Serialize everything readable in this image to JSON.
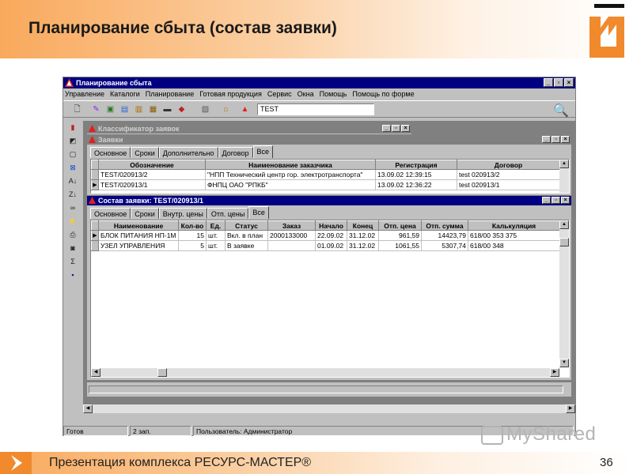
{
  "slide": {
    "title": "Планирование сбыта (состав заявки)",
    "footer_text": "Презентация комплекса РЕСУРС-МАСТЕР®",
    "page_number": "36",
    "watermark": "MyShared"
  },
  "app": {
    "title": "Планирование сбыта",
    "menu": [
      "Управление",
      "Каталоги",
      "Планирование",
      "Готовая продукция",
      "Сервис",
      "Окна",
      "Помощь",
      "Помощь по форме"
    ],
    "search_value": "TEST"
  },
  "classifier_window": {
    "title": "Классификатор заявок"
  },
  "orders_window": {
    "title": "Заявки",
    "tabs": [
      "Основное",
      "Сроки",
      "Дополнительно",
      "Договор",
      "Все"
    ],
    "columns": [
      "Обозначение",
      "Наименование заказчика",
      "Регистрация",
      "Договор"
    ],
    "rows": [
      [
        "TEST/020913/2",
        "\"НПП Технический центр гор. электротранспорта\"",
        "13.09.02 12:39:15",
        "test 020913/2"
      ],
      [
        "TEST/020913/1",
        "ФНПЦ ОАО \"РПКБ\"",
        "13.09.02 12:36:22",
        "test 020913/1"
      ]
    ]
  },
  "composition_window": {
    "title": "Состав заявки: TEST/020913/1",
    "tabs": [
      "Основное",
      "Сроки",
      "Внутр. цены",
      "Отп. цены",
      "Все"
    ],
    "columns": [
      "Наименование",
      "Кол-во",
      "Ед.",
      "Статус",
      "Заказ",
      "Начало",
      "Конец",
      "Отп. цена",
      "Отп. сумма",
      "Калькуляция"
    ],
    "rows": [
      [
        "БЛОК ПИТАНИЯ НП-1М",
        "15",
        "шт.",
        "Вкл. в план",
        "2000133000",
        "22.09.02",
        "31.12.02",
        "961,59",
        "14423,79",
        "618/00 353 375"
      ],
      [
        "УЗЕЛ УПРАВЛЕНИЯ",
        "5",
        "шт.",
        "В заявке",
        "",
        "01.09.02",
        "31.12.02",
        "1061,55",
        "5307,74",
        "618/00 348"
      ]
    ]
  },
  "statusbar": {
    "ready": "Готов",
    "records": "2 зап.",
    "user": "Пользователь: Администратор"
  },
  "colors": {
    "accent": "#f08a2c",
    "titlebar": "#000080",
    "window": "#c0c0c0"
  }
}
